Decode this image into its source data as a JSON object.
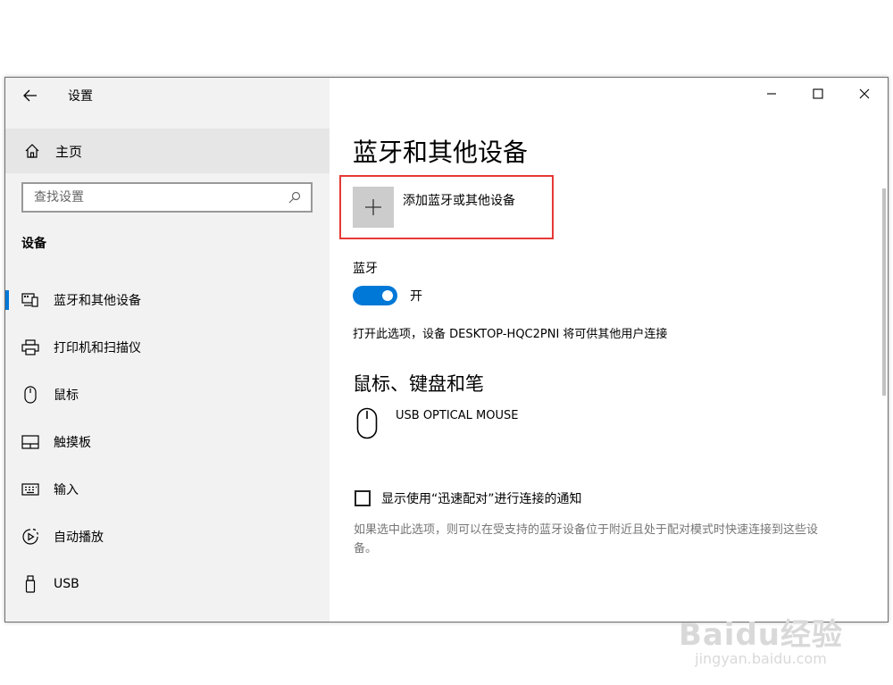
{
  "window": {
    "title": "设置"
  },
  "sidebar": {
    "home_label": "主页",
    "search_placeholder": "查找设置",
    "section_title": "设备",
    "items": [
      {
        "label": "蓝牙和其他设备",
        "icon": "devices-icon",
        "active": true
      },
      {
        "label": "打印机和扫描仪",
        "icon": "printer-icon"
      },
      {
        "label": "鼠标",
        "icon": "mouse-icon"
      },
      {
        "label": "触摸板",
        "icon": "touchpad-icon"
      },
      {
        "label": "输入",
        "icon": "keyboard-icon"
      },
      {
        "label": "自动播放",
        "icon": "autoplay-icon"
      },
      {
        "label": "USB",
        "icon": "usb-icon"
      }
    ]
  },
  "main": {
    "page_title": "蓝牙和其他设备",
    "add_device_label": "添加蓝牙或其他设备",
    "bluetooth_label": "蓝牙",
    "bluetooth_state": "开",
    "bluetooth_enabled": true,
    "bluetooth_desc": "打开此选项，设备 DESKTOP-HQC2PNI 将可供其他用户连接",
    "input_section_title": "鼠标、键盘和笔",
    "mouse_device_name": "USB OPTICAL MOUSE",
    "swift_pair_label": "显示使用“迅速配对”进行连接的通知",
    "swift_pair_checked": false,
    "swift_pair_desc": "如果选中此选项，则可以在受支持的蓝牙设备位于附近且处于配对模式时快速连接到这些设备。"
  },
  "watermark": {
    "logo": "Baidu经验",
    "url": "jingyan.baidu.com"
  },
  "colors": {
    "accent": "#0078d7",
    "highlight": "#e53935"
  }
}
